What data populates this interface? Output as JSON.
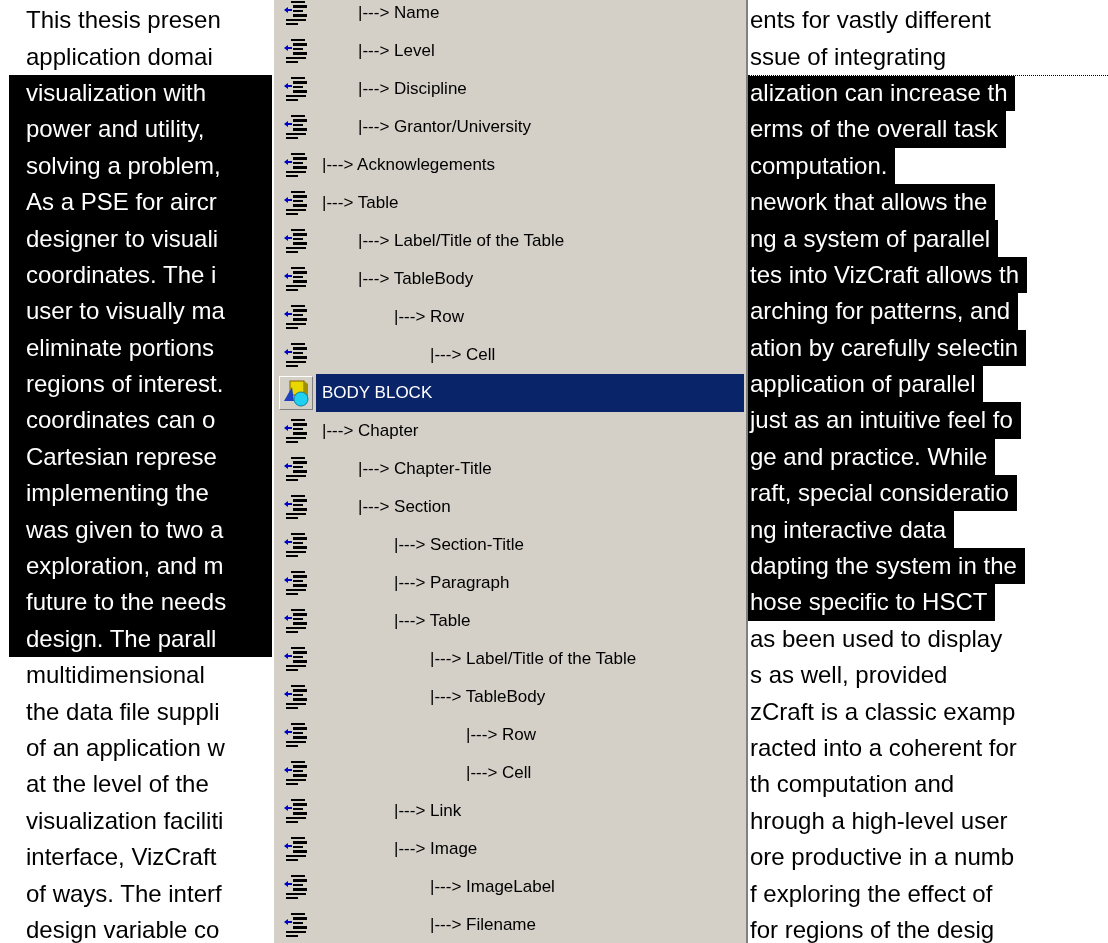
{
  "document": {
    "lines": [
      {
        "left": {
          "text": "This thesis presen",
          "selected": false
        },
        "right": {
          "text": "ents for vastly different",
          "selected": false
        }
      },
      {
        "left": {
          "text": "application domai",
          "selected": false
        },
        "right": {
          "text": "ssue of integrating",
          "selected": false
        }
      },
      {
        "left": {
          "text": "visualization with",
          "selected": true
        },
        "right": {
          "text": "alization can increase th",
          "selected": true
        }
      },
      {
        "left": {
          "text": "power and utility,",
          "selected": true
        },
        "right": {
          "text": "erms of the overall task",
          "selected": true
        }
      },
      {
        "left": {
          "text": "solving a problem,",
          "selected": true
        },
        "right": {
          "text": "computation.",
          "selected": true
        }
      },
      {
        "left": {
          "text": "As a PSE for aircr",
          "selected": true
        },
        "right": {
          "text": "nework that allows the",
          "selected": true
        }
      },
      {
        "left": {
          "text": "designer to visuali",
          "selected": true
        },
        "right": {
          "text": "ng a system of parallel",
          "selected": true
        }
      },
      {
        "left": {
          "text": "coordinates. The i",
          "selected": true
        },
        "right": {
          "text": "tes into VizCraft allows th",
          "selected": true
        }
      },
      {
        "left": {
          "text": "user to visually ma",
          "selected": true
        },
        "right": {
          "text": "arching for patterns, and",
          "selected": true
        }
      },
      {
        "left": {
          "text": "eliminate portions",
          "selected": true
        },
        "right": {
          "text": "ation by carefully selectin",
          "selected": true
        }
      },
      {
        "left": {
          "text": "regions of interest.",
          "selected": true
        },
        "right": {
          "text": "application of parallel",
          "selected": true
        }
      },
      {
        "left": {
          "text": "coordinates can o",
          "selected": true
        },
        "right": {
          "text": "just as an intuitive feel fo",
          "selected": true
        }
      },
      {
        "left": {
          "text": "Cartesian represe",
          "selected": true
        },
        "right": {
          "text": "ge and practice. While",
          "selected": true
        }
      },
      {
        "left": {
          "text": "implementing the",
          "selected": true
        },
        "right": {
          "text": "raft, special consideratio",
          "selected": true
        }
      },
      {
        "left": {
          "text": "was given to two a",
          "selected": true
        },
        "right": {
          "text": "ng interactive data",
          "selected": true
        }
      },
      {
        "left": {
          "text": "exploration, and m",
          "selected": true
        },
        "right": {
          "text": "dapting the system in the",
          "selected": true
        }
      },
      {
        "left": {
          "text": "future to the needs",
          "selected": true
        },
        "right": {
          "text": "hose specific to HSCT",
          "selected": true
        }
      },
      {
        "left": {
          "text": "design. The parall",
          "selected": true
        },
        "right": {
          "text": "as been used to display",
          "selected": false
        }
      },
      {
        "left": {
          "text": "multidimensional",
          "selected": false
        },
        "right": {
          "text": "s as well, provided",
          "selected": false
        }
      },
      {
        "left": {
          "text": "the data file suppli",
          "selected": false
        },
        "right": {
          "text": "zCraft is a classic examp",
          "selected": false
        }
      },
      {
        "left": {
          "text": "of an application w",
          "selected": false
        },
        "right": {
          "text": "racted into a coherent for",
          "selected": false
        }
      },
      {
        "left": {
          "text": "at the level of the",
          "selected": false
        },
        "right": {
          "text": "th computation and",
          "selected": false
        }
      },
      {
        "left": {
          "text": "visualization faciliti",
          "selected": false
        },
        "right": {
          "text": "hrough a high-level user",
          "selected": false
        }
      },
      {
        "left": {
          "text": "interface, VizCraft",
          "selected": false
        },
        "right": {
          "text": "ore productive in a numb",
          "selected": false
        }
      },
      {
        "left": {
          "text": "of ways. The interf",
          "selected": false
        },
        "right": {
          "text": "f exploring the effect of",
          "selected": false
        }
      },
      {
        "left": {
          "text": "design variable co",
          "selected": false
        },
        "right": {
          "text": "for regions of the desig",
          "selected": false
        }
      }
    ]
  },
  "menu": {
    "items": [
      {
        "children": [
          {
            "children": [
              {
                "label": "|---> Name",
                "selected": false
              },
              {
                "label": "|---> Level",
                "selected": false
              },
              {
                "label": "|---> Discipline",
                "selected": false
              },
              {
                "label": "|---> Grantor/University",
                "selected": false
              }
            ]
          },
          {
            "label": "|---> Acknowlegements",
            "selected": false
          },
          {
            "label": "|---> Table",
            "selected": false,
            "children": [
              {
                "label": "|---> Label/Title of the Table",
                "selected": false
              },
              {
                "label": "|---> TableBody",
                "selected": false,
                "children": [
                  {
                    "label": "|---> Row",
                    "selected": false,
                    "children": [
                      {
                        "label": "|---> Cell",
                        "selected": false
                      }
                    ]
                  }
                ]
              }
            ]
          }
        ]
      },
      {
        "label": "BODY BLOCK",
        "selected": true,
        "children": [
          {
            "label": "|---> Chapter",
            "selected": false,
            "children": [
              {
                "label": "|---> Chapter-Title",
                "selected": false
              },
              {
                "label": "|---> Section",
                "selected": false,
                "children": [
                  {
                    "label": "|---> Section-Title",
                    "selected": false
                  },
                  {
                    "label": "|---> Paragraph",
                    "selected": false
                  },
                  {
                    "label": "|---> Table",
                    "selected": false,
                    "children": [
                      {
                        "label": "|---> Label/Title of the Table",
                        "selected": false
                      },
                      {
                        "label": "|---> TableBody",
                        "selected": false,
                        "children": [
                          {
                            "label": "|---> Row",
                            "selected": false
                          },
                          {
                            "label": "|---> Cell",
                            "selected": false
                          }
                        ]
                      }
                    ]
                  },
                  {
                    "label": "|---> Link",
                    "selected": false
                  },
                  {
                    "label": "|---> Image",
                    "selected": false,
                    "children": [
                      {
                        "label": "|---> ImageLabel",
                        "selected": false
                      },
                      {
                        "label": "|---> Filename",
                        "selected": false
                      }
                    ]
                  }
                ]
              }
            ]
          }
        ]
      }
    ]
  }
}
